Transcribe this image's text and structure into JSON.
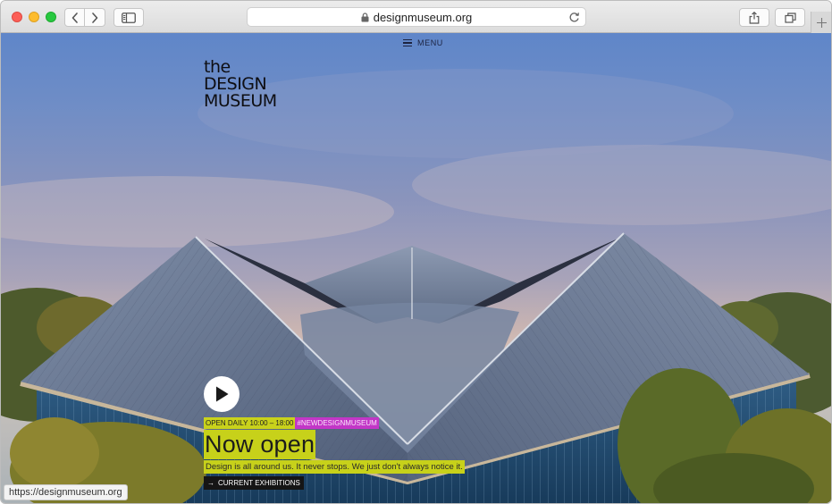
{
  "browser": {
    "url_display": "designmuseum.org",
    "status_url": "https://designmuseum.org"
  },
  "nav": {
    "menu_label": "MENU"
  },
  "logo": {
    "line1": "the",
    "line2": "DESIGN",
    "line3": "MUSEUM"
  },
  "hero": {
    "hours_tag": "OPEN DAILY 10:00 – 18:00",
    "hashtag": "#NEWDESIGNMUSEUM",
    "title": "Now open",
    "subtitle": "Design is all around us. It never stops. We just don't always notice it.",
    "cta_label": "CURRENT EXHIBITIONS",
    "cta_arrow": "→"
  },
  "icons": {
    "back": "chevron-left-icon",
    "forward": "chevron-right-icon",
    "sidebar": "sidebar-icon",
    "lock": "lock-icon",
    "reload": "reload-icon",
    "share": "share-icon",
    "tabs": "tabs-icon",
    "new_tab": "plus-icon",
    "menu": "hamburger-icon",
    "play": "play-icon"
  },
  "colors": {
    "accent_yellow": "#c7d11a",
    "accent_magenta": "#c236c7",
    "cta_black": "#151515"
  }
}
